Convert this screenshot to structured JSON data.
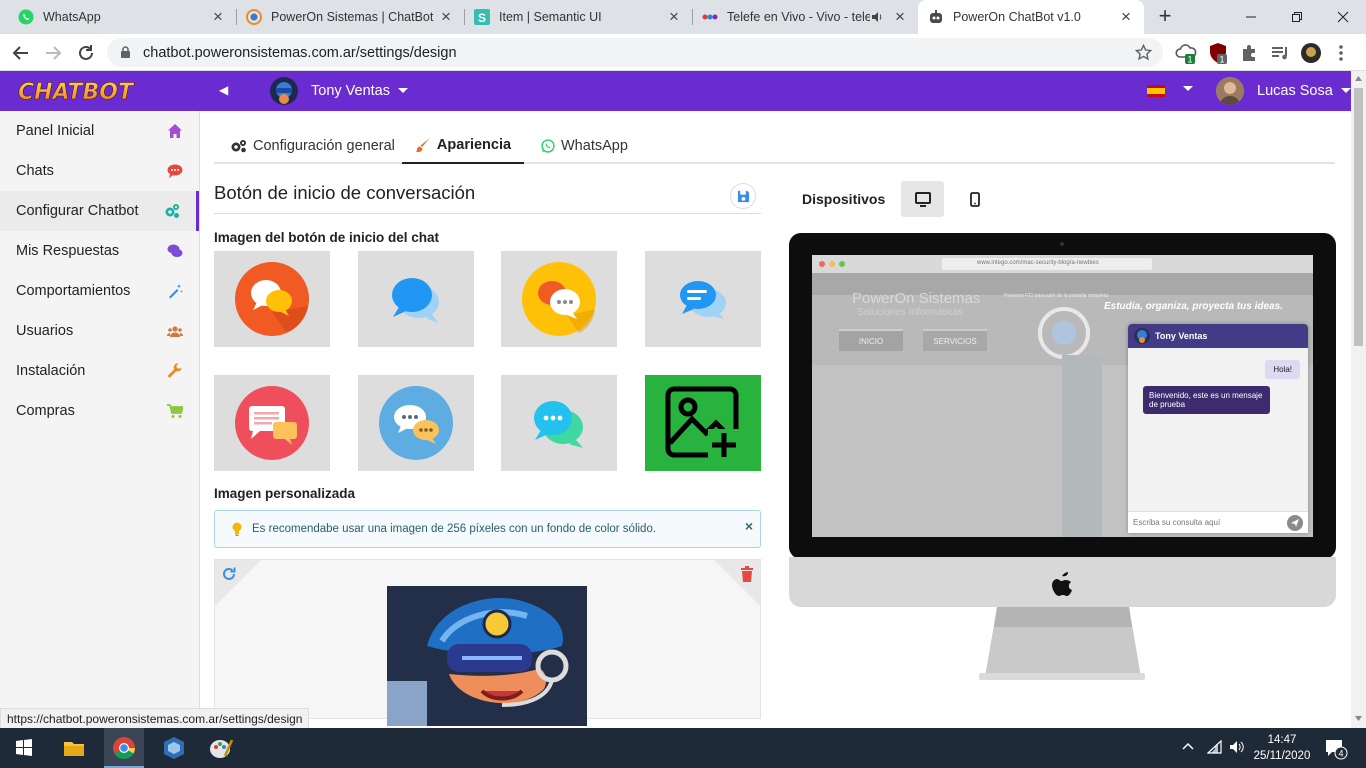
{
  "browser": {
    "tabs": [
      {
        "title": "WhatsApp",
        "icon": "whatsapp-icon",
        "active": false
      },
      {
        "title": "PowerOn Sistemas | ChatBot",
        "icon": "poweron-icon",
        "active": false
      },
      {
        "title": "Item | Semantic UI",
        "icon": "semantic-ui-icon",
        "active": false
      },
      {
        "title": "Telefe en Vivo - Vivo - tele",
        "icon": "telefe-icon",
        "active": false
      },
      {
        "title": "PowerOn ChatBot v1.0",
        "icon": "chatbot-icon",
        "active": true
      }
    ],
    "url": "chatbot.poweronsistemas.com.ar/settings/design",
    "status_url": "https://chatbot.poweronsistemas.com.ar/settings/design",
    "badges": {
      "cloud": "1",
      "ublock": "1"
    }
  },
  "app": {
    "logo_text": "CHATBOT",
    "account_name": "Tony Ventas",
    "language_flag": "es",
    "user_name": "Lucas Sosa",
    "colors": {
      "primary": "#6a2bd1",
      "sidebar_bg": "#f4f4f4",
      "tip_border": "#a9d4e1"
    }
  },
  "sidebar": {
    "items": [
      {
        "label": "Panel Inicial",
        "icon": "home-icon",
        "color": "#a34fd0"
      },
      {
        "label": "Chats",
        "icon": "chat-icon",
        "color": "#e5483f"
      },
      {
        "label": "Configurar Chatbot",
        "icon": "cogs-icon",
        "color": "#1bb1a6",
        "active": true
      },
      {
        "label": "Mis Respuestas",
        "icon": "comments-icon",
        "color": "#7c4dd6"
      },
      {
        "label": "Comportamientos",
        "icon": "magic-wand-icon",
        "color": "#3a8ee6"
      },
      {
        "label": "Usuarios",
        "icon": "users-icon",
        "color": "#d27b3e"
      },
      {
        "label": "Instalación",
        "icon": "wrench-icon",
        "color": "#ee8a26"
      },
      {
        "label": "Compras",
        "icon": "cart-icon",
        "color": "#8ec63f"
      }
    ]
  },
  "main": {
    "tabs": [
      {
        "label": "Configuración general",
        "icon": "cogs-icon"
      },
      {
        "label": "Apariencia",
        "icon": "paintbrush-icon",
        "active": true
      },
      {
        "label": "WhatsApp",
        "icon": "whatsapp-icon"
      }
    ],
    "section_title": "Botón de inicio de conversación",
    "image_label": "Imagen del botón de inicio del chat",
    "custom_label": "Imagen personalizada",
    "tip": "Es recomendabe usar una imagen de 256 píxeles con un fondo de color sólido.",
    "tip_close": "×"
  },
  "preview": {
    "devices_label": "Dispositivos",
    "site": {
      "url": "www.intego.com/mac-security-blog/a-newbies",
      "brand": "PowerOn Sistemas",
      "brand_sub": "Soluciones Informáticas",
      "fullscreen_hint": "Presiona F11 para salir de la pantalla completa",
      "slogan": "Estudia, organiza, proyecta tus ideas.",
      "menu": [
        "INICIO",
        "SERVICIOS"
      ]
    },
    "chat": {
      "agent": "Tony Ventas",
      "user_message": "Hola!",
      "bot_message": "Bienvenido, este es un mensaje de prueba",
      "input_placeholder": "Escriba su consulta aquí"
    }
  },
  "taskbar": {
    "time": "14:47",
    "date": "25/11/2020",
    "notifications": "4"
  }
}
